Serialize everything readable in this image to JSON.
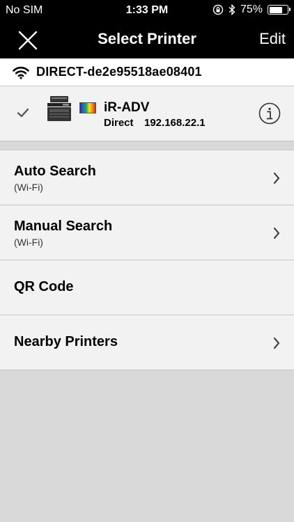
{
  "status_bar": {
    "carrier": "No SIM",
    "time": "1:33 PM",
    "battery_percent": "75%",
    "battery_level": 0.75
  },
  "nav": {
    "title": "Select Printer",
    "edit_label": "Edit"
  },
  "network": {
    "ssid": "DIRECT-de2e95518ae08401"
  },
  "printer": {
    "name": "iR-ADV",
    "connection": "Direct",
    "ip": "192.168.22.1"
  },
  "menu": {
    "auto_search": {
      "label": "Auto Search",
      "sub": "(Wi-Fi)"
    },
    "manual_search": {
      "label": "Manual Search",
      "sub": "(Wi-Fi)"
    },
    "qr_code": {
      "label": "QR Code"
    },
    "nearby_printers": {
      "label": "Nearby Printers"
    }
  }
}
